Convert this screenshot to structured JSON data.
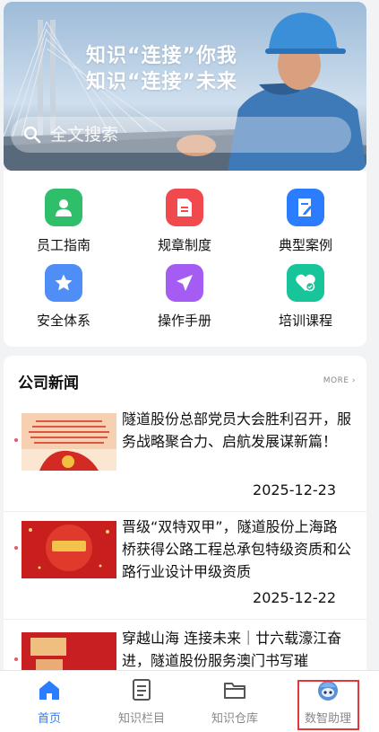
{
  "hero": {
    "line1": "知识“连接”你我",
    "line2": "知识“连接”未来"
  },
  "search": {
    "placeholder": "全文搜索"
  },
  "quick": [
    {
      "label": "员工指南",
      "color": "#2fbf6a",
      "icon": "person-icon"
    },
    {
      "label": "规章制度",
      "color": "#f04a4f",
      "icon": "document-icon"
    },
    {
      "label": "典型案例",
      "color": "#2b7cff",
      "icon": "edit-document-icon"
    },
    {
      "label": "安全体系",
      "color": "#4f8ef7",
      "icon": "star-icon"
    },
    {
      "label": "操作手册",
      "color": "#a45cf2",
      "icon": "send-icon"
    },
    {
      "label": "培训课程",
      "color": "#18c49a",
      "icon": "heart-check-icon"
    }
  ],
  "news": {
    "title": "公司新闻",
    "more": "MORE",
    "items": [
      {
        "text": "隧道股份总部党员大会胜利召开，服务战略聚合力、启航发展谋新篇！",
        "date": "2025-12-23"
      },
      {
        "text": "晋级“双特双甲”，隧道股份上海路桥获得公路工程总承包特级资质和公路行业设计甲级资质",
        "date": "2025-12-22"
      },
      {
        "text": "穿越山海 连接未来｜廿六载濠江奋进，隧道股份服务澳门书写璀",
        "date": ""
      }
    ]
  },
  "tabs": [
    {
      "label": "首页",
      "icon": "home-icon",
      "active": true
    },
    {
      "label": "知识栏目",
      "icon": "list-document-icon",
      "active": false
    },
    {
      "label": "知识仓库",
      "icon": "folder-icon",
      "active": false
    },
    {
      "label": "数智助理",
      "icon": "robot-assistant-icon",
      "active": false
    }
  ],
  "colors": {
    "accent": "#2b7cff",
    "highlight": "#e4363b"
  }
}
